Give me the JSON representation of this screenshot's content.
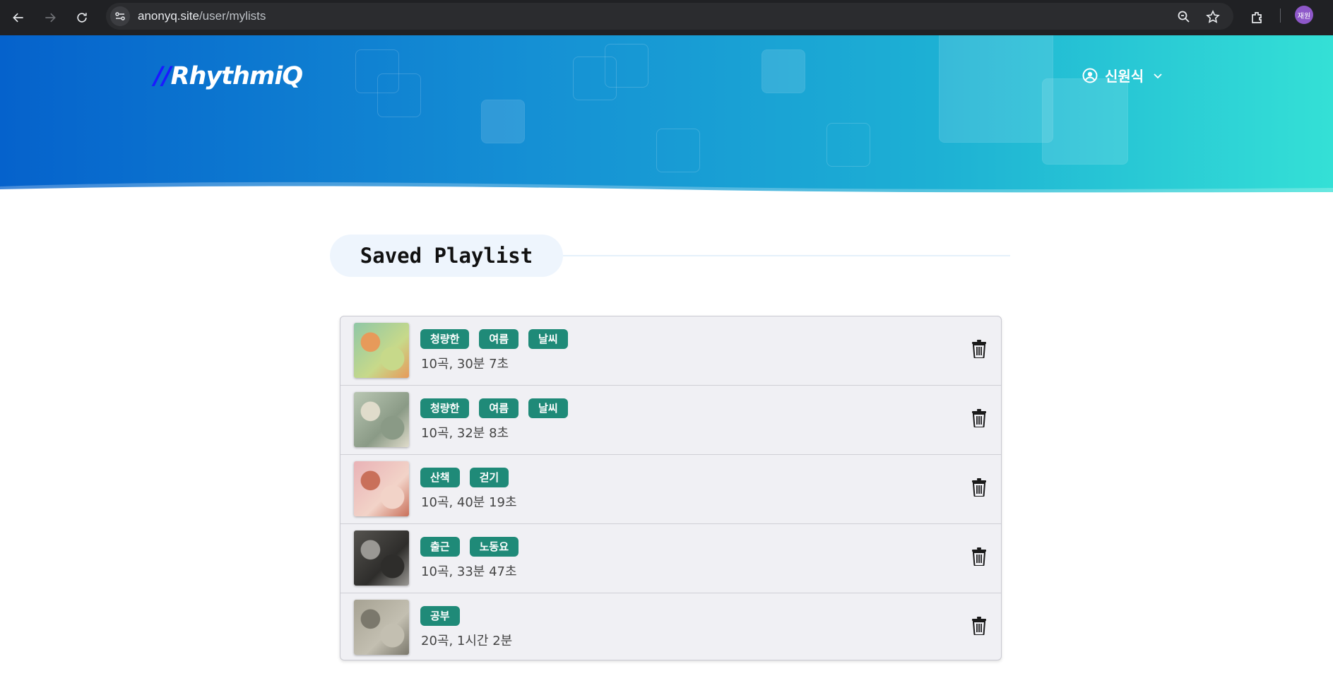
{
  "browser": {
    "url_host": "anonyq.site",
    "url_path": "/user/mylists",
    "profile_initials": "재원"
  },
  "header": {
    "logo_slash": "//",
    "logo_text": "RhythmiQ",
    "user_name": "신원식"
  },
  "section": {
    "title": "Saved Playlist"
  },
  "playlists": [
    {
      "tags": [
        "청량한",
        "여름",
        "날씨"
      ],
      "meta": "10곡, 30분 7초",
      "thumb_colors": [
        "#8fc7a6",
        "#e79a5a",
        "#c7d98a"
      ]
    },
    {
      "tags": [
        "청량한",
        "여름",
        "날씨"
      ],
      "meta": "10곡, 32분 8초",
      "thumb_colors": [
        "#b9c7b3",
        "#e0dccb",
        "#8a9a86"
      ]
    },
    {
      "tags": [
        "산책",
        "걷기"
      ],
      "meta": "10곡, 40분 19초",
      "thumb_colors": [
        "#e9b2b6",
        "#c9705a",
        "#f2d3c8"
      ]
    },
    {
      "tags": [
        "출근",
        "노동요"
      ],
      "meta": "10곡, 33분 47초",
      "thumb_colors": [
        "#55534f",
        "#9a9894",
        "#2e2d2b"
      ]
    },
    {
      "tags": [
        "공부"
      ],
      "meta": "20곡, 1시간 2분",
      "thumb_colors": [
        "#a6a293",
        "#7b786c",
        "#c3bfb1"
      ]
    }
  ]
}
